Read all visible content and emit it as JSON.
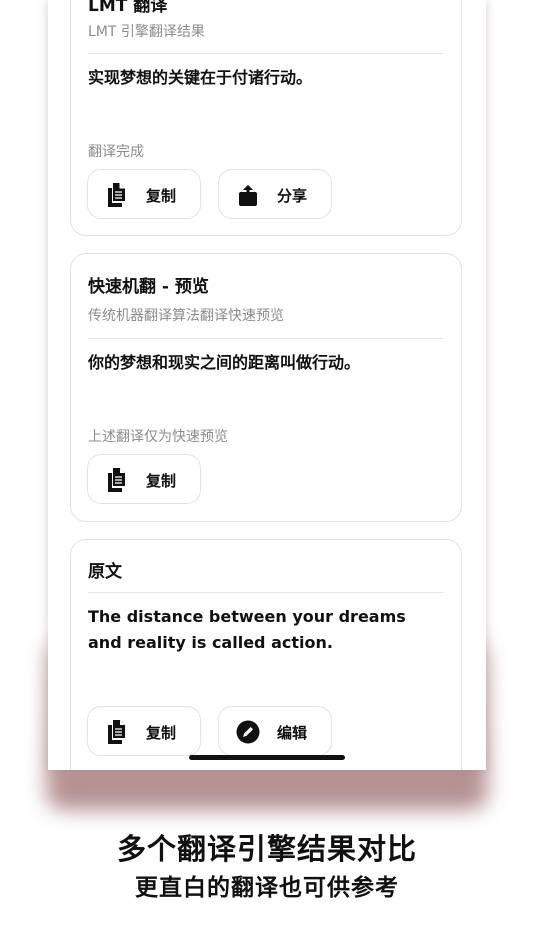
{
  "card_top": {
    "title": "LMT 翻译",
    "subtitle": "LMT 引擎翻译结果",
    "text": "实现梦想的关键在于付诸行动。",
    "note": "翻译完成",
    "copy_label": "复制",
    "share_label": "分享"
  },
  "card_fast": {
    "title": "快速机翻 - 预览",
    "subtitle": "传统机器翻译算法翻译快速预览",
    "text": "你的梦想和现实之间的距离叫做行动。",
    "note": "上述翻译仅为快速预览",
    "copy_label": "复制"
  },
  "card_source": {
    "title": "原文",
    "text": "The distance between your dreams and reality is called action.",
    "copy_label": "复制",
    "edit_label": "编辑"
  },
  "caption": {
    "line1": "多个翻译引擎结果对比",
    "line2": "更直白的翻译也可供参考"
  }
}
